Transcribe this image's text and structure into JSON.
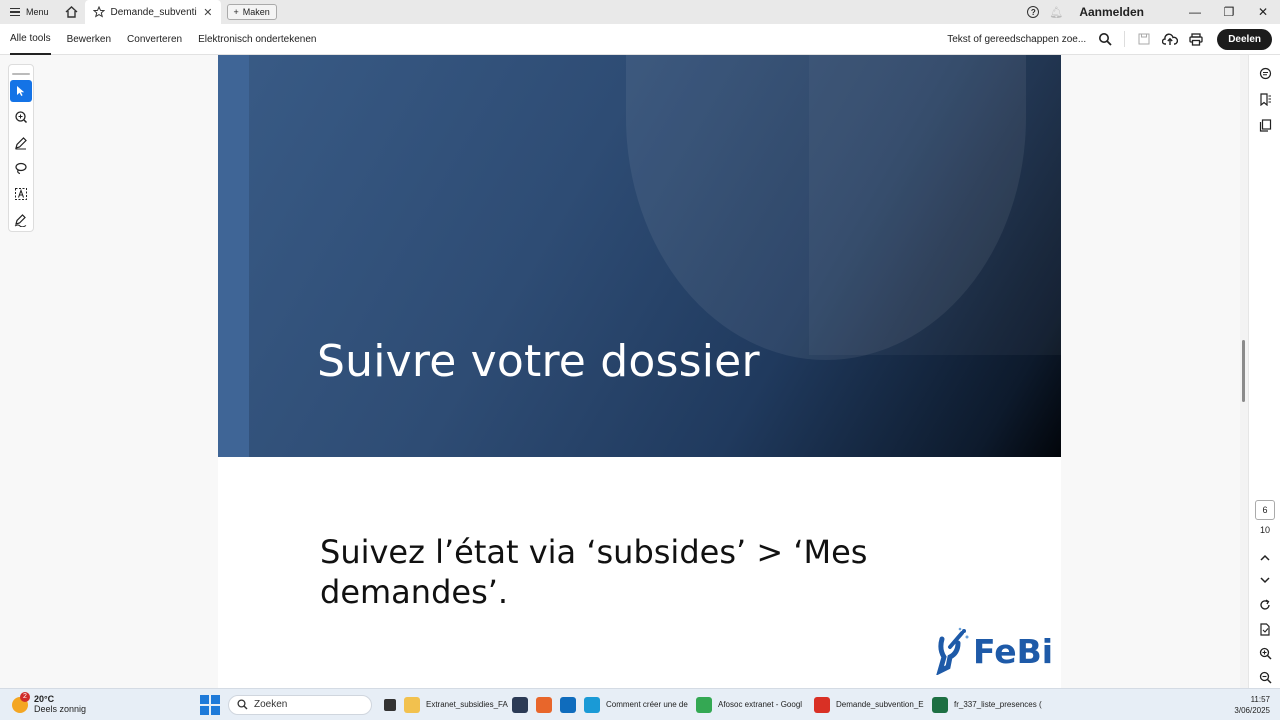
{
  "tabbar": {
    "menu_label": "Menu",
    "tab_title": "Demande_subventio...",
    "new_tab_label": "Maken",
    "sign_in_label": "Aanmelden"
  },
  "toolbar": {
    "items": [
      "Alle tools",
      "Bewerken",
      "Converteren",
      "Elektronisch ondertekenen"
    ],
    "search_placeholder": "Tekst of gereedschappen zoe...",
    "share_label": "Deelen"
  },
  "document": {
    "slide1_heading": "Suivre votre dossier",
    "slide2_body": "Suivez l’état via ‘subsides’ > ‘Mes demandes’.",
    "logo_text": "FeBi"
  },
  "page_nav": {
    "current_page": "6",
    "total_pages": "10"
  },
  "taskbar": {
    "weather_temp": "20°C",
    "weather_desc": "Deels zonnig",
    "weather_badge": "2",
    "search_placeholder": "Zoeken",
    "apps": [
      {
        "label": "Extranet_subsidies_FAQ",
        "color": "#f2c14e"
      },
      {
        "label": "",
        "color": "#2b3a55"
      },
      {
        "label": "",
        "color": "#e8662b"
      },
      {
        "label": "",
        "color": "#0f6cbd"
      },
      {
        "label": "Comment créer une de",
        "color": "#1a9ad6"
      },
      {
        "label": "Afosoc extranet - Googl",
        "color": "#34a853"
      },
      {
        "label": "Demande_subvention_E",
        "color": "#d93025"
      },
      {
        "label": "fr_337_liste_presences (",
        "color": "#1d6f42"
      }
    ],
    "time": "11:57",
    "date": "3/06/2025"
  },
  "colors": {
    "accent": "#1473e6",
    "slide_dark": "#203a5e",
    "logo_blue": "#1e5aa8"
  }
}
